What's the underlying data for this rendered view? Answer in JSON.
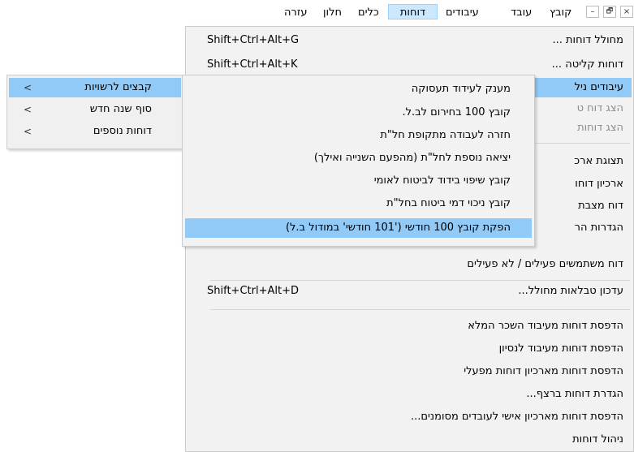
{
  "window_controls": {
    "close": "×",
    "restore": "🗗",
    "minimize": "–"
  },
  "menubar": {
    "items": [
      "קובץ",
      "עובד",
      "עיבודים",
      "דוחות",
      "כלים",
      "חלון",
      "עזרה"
    ]
  },
  "reports_menu": {
    "items": [
      {
        "label": "מחולל דוחות ...",
        "shortcut": "Shift+Ctrl+Alt+G"
      },
      {
        "label": "דוחות קליטה ...",
        "shortcut": "Shift+Ctrl+Alt+K"
      },
      {
        "label": "עיבודים ניל"
      },
      {
        "label": "הצג דוח ט"
      },
      {
        "label": "הצג דוחות"
      },
      {
        "label": "תצוגת ארכ"
      },
      {
        "label": "ארכיון דוחו"
      },
      {
        "label": "דוח מצבת"
      },
      {
        "label": "הגדרות הר"
      },
      {
        "label": "דוח משתמשים פעילים / לא פעילים"
      },
      {
        "label": "עדכון טבלאות מחולל...",
        "shortcut": "Shift+Ctrl+Alt+D"
      },
      {
        "label": "הדפסת דוחות מעיבוד השכר המלא"
      },
      {
        "label": "הדפסת דוחות מעיבוד לנסיון"
      },
      {
        "label": "הדפסת דוחות מארכיון דוחות מפעלי"
      },
      {
        "label": "הגדרת דוחות ברצף..."
      },
      {
        "label": "הדפסת דוחות מארכיון אישי לעובדים מסומנים..."
      },
      {
        "label": "ניהול דוחות"
      }
    ]
  },
  "processing_submenu": {
    "items": [
      "מענק לעידוד תעסוקה",
      "קובץ 100 בחירום לב.ל.",
      "חזרה לעבודה מתקופת חל\"ת",
      "יציאה נוספת לחל\"ת (מהפעם השנייה ואילך)",
      "קובץ שיפוי בידוד לביטוח לאומי",
      "קובץ ניכוי דמי ביטוח בחל\"ת",
      "הפקת קובץ 100 חודשי ('101 חודשי' במודול ב.ל)"
    ]
  },
  "left_submenu": {
    "items": [
      "קבצים לרשויות",
      "סוף שנה חדש",
      "דוחות נוספים"
    ],
    "chevron": "<"
  }
}
